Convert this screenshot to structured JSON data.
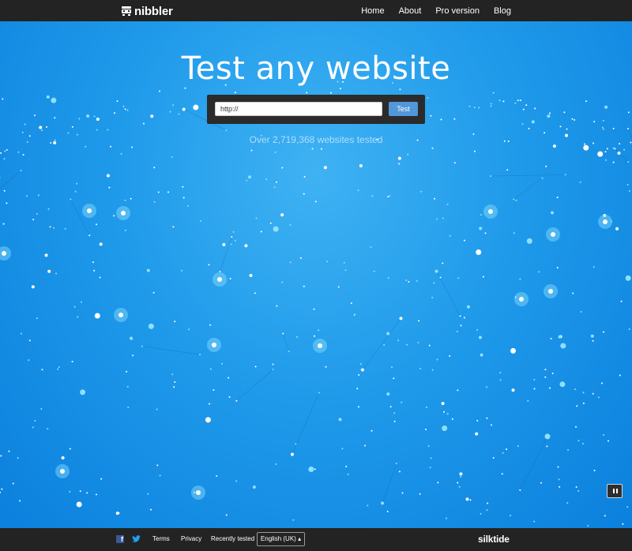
{
  "header": {
    "logo_text": "nibbler",
    "nav": [
      "Home",
      "About",
      "Pro version",
      "Blog"
    ]
  },
  "hero": {
    "title": "Test any website",
    "url_placeholder": "http://",
    "test_label": "Test",
    "counter": "Over 2,719,368 websites tested"
  },
  "footer": {
    "facebook_icon": "f",
    "links": [
      "Terms",
      "Privacy",
      "Recently tested"
    ],
    "language": "English (UK)",
    "brand": "silktide"
  },
  "colors": {
    "bar": "#232323",
    "background_top": "#3fb2f3",
    "background_bottom": "#0b80dd",
    "button": "#5197d9"
  },
  "icons": [
    "nibbler-robot-icon",
    "facebook-icon",
    "twitter-icon",
    "pause-icon",
    "caret-up-icon"
  ]
}
